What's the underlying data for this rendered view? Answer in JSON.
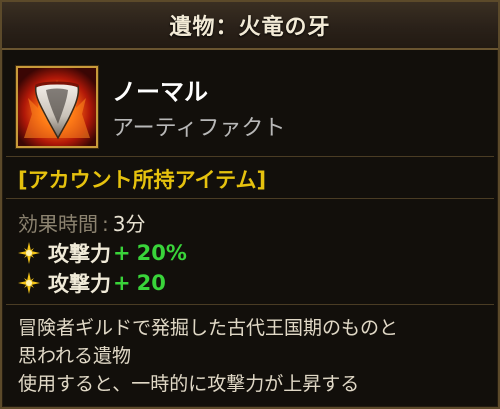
{
  "header": {
    "title": "遺物：火竜の牙"
  },
  "item": {
    "icon": "dragon-fang-icon",
    "rarity": "ノーマル",
    "category": "アーティファクト"
  },
  "account_bound": "[アカウント所持アイテム]",
  "effects": {
    "duration_label": "効果時間",
    "duration_separator": ":",
    "duration_value": "3分",
    "stats": [
      {
        "label": "攻撃力",
        "plus": "+",
        "value": "20%"
      },
      {
        "label": "攻撃力",
        "plus": "+",
        "value": "20"
      }
    ]
  },
  "description": {
    "lines": [
      "冒険者ギルドで発掘した古代王国期のものと",
      "思われる遺物",
      "使用すると、一時的に攻撃力が上昇する"
    ]
  },
  "colors": {
    "title": "#f2ead6",
    "account_bound": "#e6c20e",
    "stat_value": "#39d43a",
    "frame_gold": "#c79a3a"
  }
}
